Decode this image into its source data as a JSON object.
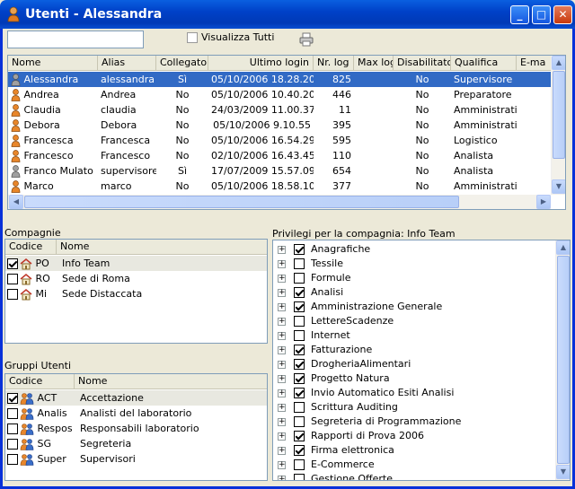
{
  "window": {
    "title": "Utenti - Alessandra",
    "minimize_label": "_",
    "maximize_label": "□",
    "close_label": "✕"
  },
  "toolbar": {
    "search_value": "",
    "show_all_label": "Visualizza Tutti",
    "show_all_checked": false
  },
  "users": {
    "columns": [
      "Nome",
      "Alias",
      "Collegato",
      "Ultimo login",
      "Nr. log",
      "Max log",
      "Disabilitato",
      "Qualifica",
      "E-ma"
    ],
    "rows": [
      {
        "nome": "Alessandra",
        "alias": "alessandra",
        "collegato": "Sì",
        "login": "05/10/2006 18.28.20",
        "nrlog": "825",
        "maxlog": "",
        "disabilitato": "No",
        "qualifica": "Supervisore",
        "selected": true,
        "icon": "user-grey-icon"
      },
      {
        "nome": "Andrea",
        "alias": "Andrea",
        "collegato": "No",
        "login": "05/10/2006 10.40.20",
        "nrlog": "446",
        "maxlog": "",
        "disabilitato": "No",
        "qualifica": "Preparatore",
        "selected": false,
        "icon": "user-orange-icon"
      },
      {
        "nome": "Claudia",
        "alias": "claudia",
        "collegato": "No",
        "login": "24/03/2009 11.00.37",
        "nrlog": "11",
        "maxlog": "",
        "disabilitato": "No",
        "qualifica": "Amministrativo",
        "selected": false,
        "icon": "user-orange-icon"
      },
      {
        "nome": "Debora",
        "alias": "Debora",
        "collegato": "No",
        "login": "05/10/2006 9.10.55",
        "nrlog": "395",
        "maxlog": "",
        "disabilitato": "No",
        "qualifica": "Amministrativo",
        "selected": false,
        "icon": "user-orange-icon"
      },
      {
        "nome": "Francesca",
        "alias": "Francesca",
        "collegato": "No",
        "login": "05/10/2006 16.54.29",
        "nrlog": "595",
        "maxlog": "",
        "disabilitato": "No",
        "qualifica": "Logistico",
        "selected": false,
        "icon": "user-orange-icon"
      },
      {
        "nome": "Francesco",
        "alias": "Francesco",
        "collegato": "No",
        "login": "02/10/2006 16.43.45",
        "nrlog": "110",
        "maxlog": "",
        "disabilitato": "No",
        "qualifica": "Analista",
        "selected": false,
        "icon": "user-orange-icon"
      },
      {
        "nome": "Franco Mulato",
        "alias": "supervisore",
        "collegato": "Sì",
        "login": "17/07/2009 15.57.09",
        "nrlog": "654",
        "maxlog": "",
        "disabilitato": "No",
        "qualifica": "Analista",
        "selected": false,
        "icon": "user-grey-icon"
      },
      {
        "nome": "Marco",
        "alias": "marco",
        "collegato": "No",
        "login": "05/10/2006 18.58.10",
        "nrlog": "377",
        "maxlog": "",
        "disabilitato": "No",
        "qualifica": "Amministrativo",
        "selected": false,
        "icon": "user-orange-icon"
      }
    ]
  },
  "companies": {
    "label": "Compagnie",
    "columns": [
      "Codice",
      "Nome"
    ],
    "rows": [
      {
        "checked": true,
        "code": "PO",
        "name": "Info Team",
        "selected": true
      },
      {
        "checked": false,
        "code": "RO",
        "name": "Sede di Roma",
        "selected": false
      },
      {
        "checked": false,
        "code": "Mi",
        "name": "Sede Distaccata",
        "selected": false
      }
    ]
  },
  "groups": {
    "label": "Gruppi Utenti",
    "columns": [
      "Codice",
      "Nome"
    ],
    "rows": [
      {
        "checked": true,
        "code": "ACT",
        "name": "Accettazione",
        "selected": true
      },
      {
        "checked": false,
        "code": "Analis",
        "name": "Analisti del laboratorio",
        "selected": false
      },
      {
        "checked": false,
        "code": "Respos",
        "name": "Responsabili laboratorio",
        "selected": false
      },
      {
        "checked": false,
        "code": "SG",
        "name": "Segreteria",
        "selected": false
      },
      {
        "checked": false,
        "code": "Super",
        "name": "Supervisori",
        "selected": false
      }
    ]
  },
  "privileges": {
    "label": "Privilegi per la compagnia: Info Team",
    "items": [
      {
        "name": "Anagrafiche",
        "checked": true
      },
      {
        "name": "Tessile",
        "checked": false
      },
      {
        "name": "Formule",
        "checked": false
      },
      {
        "name": "Analisi",
        "checked": true
      },
      {
        "name": "Amministrazione Generale",
        "checked": true
      },
      {
        "name": "LettereScadenze",
        "checked": false
      },
      {
        "name": "Internet",
        "checked": false
      },
      {
        "name": "Fatturazione",
        "checked": true
      },
      {
        "name": "DrogheriaAlimentari",
        "checked": true
      },
      {
        "name": "Progetto Natura",
        "checked": true
      },
      {
        "name": "Invio Automatico Esiti Analisi",
        "checked": true
      },
      {
        "name": "Scrittura Auditing",
        "checked": false
      },
      {
        "name": "Segreteria di Programmazione",
        "checked": false
      },
      {
        "name": "Rapporti di Prova 2006",
        "checked": true
      },
      {
        "name": "Firma elettronica",
        "checked": true
      },
      {
        "name": "E-Commerce",
        "checked": false
      },
      {
        "name": "Gestione Offerte",
        "checked": false
      }
    ]
  },
  "colors": {
    "selection": "#316ac5",
    "title_bar": "#0041c8",
    "face": "#ece9d8"
  }
}
